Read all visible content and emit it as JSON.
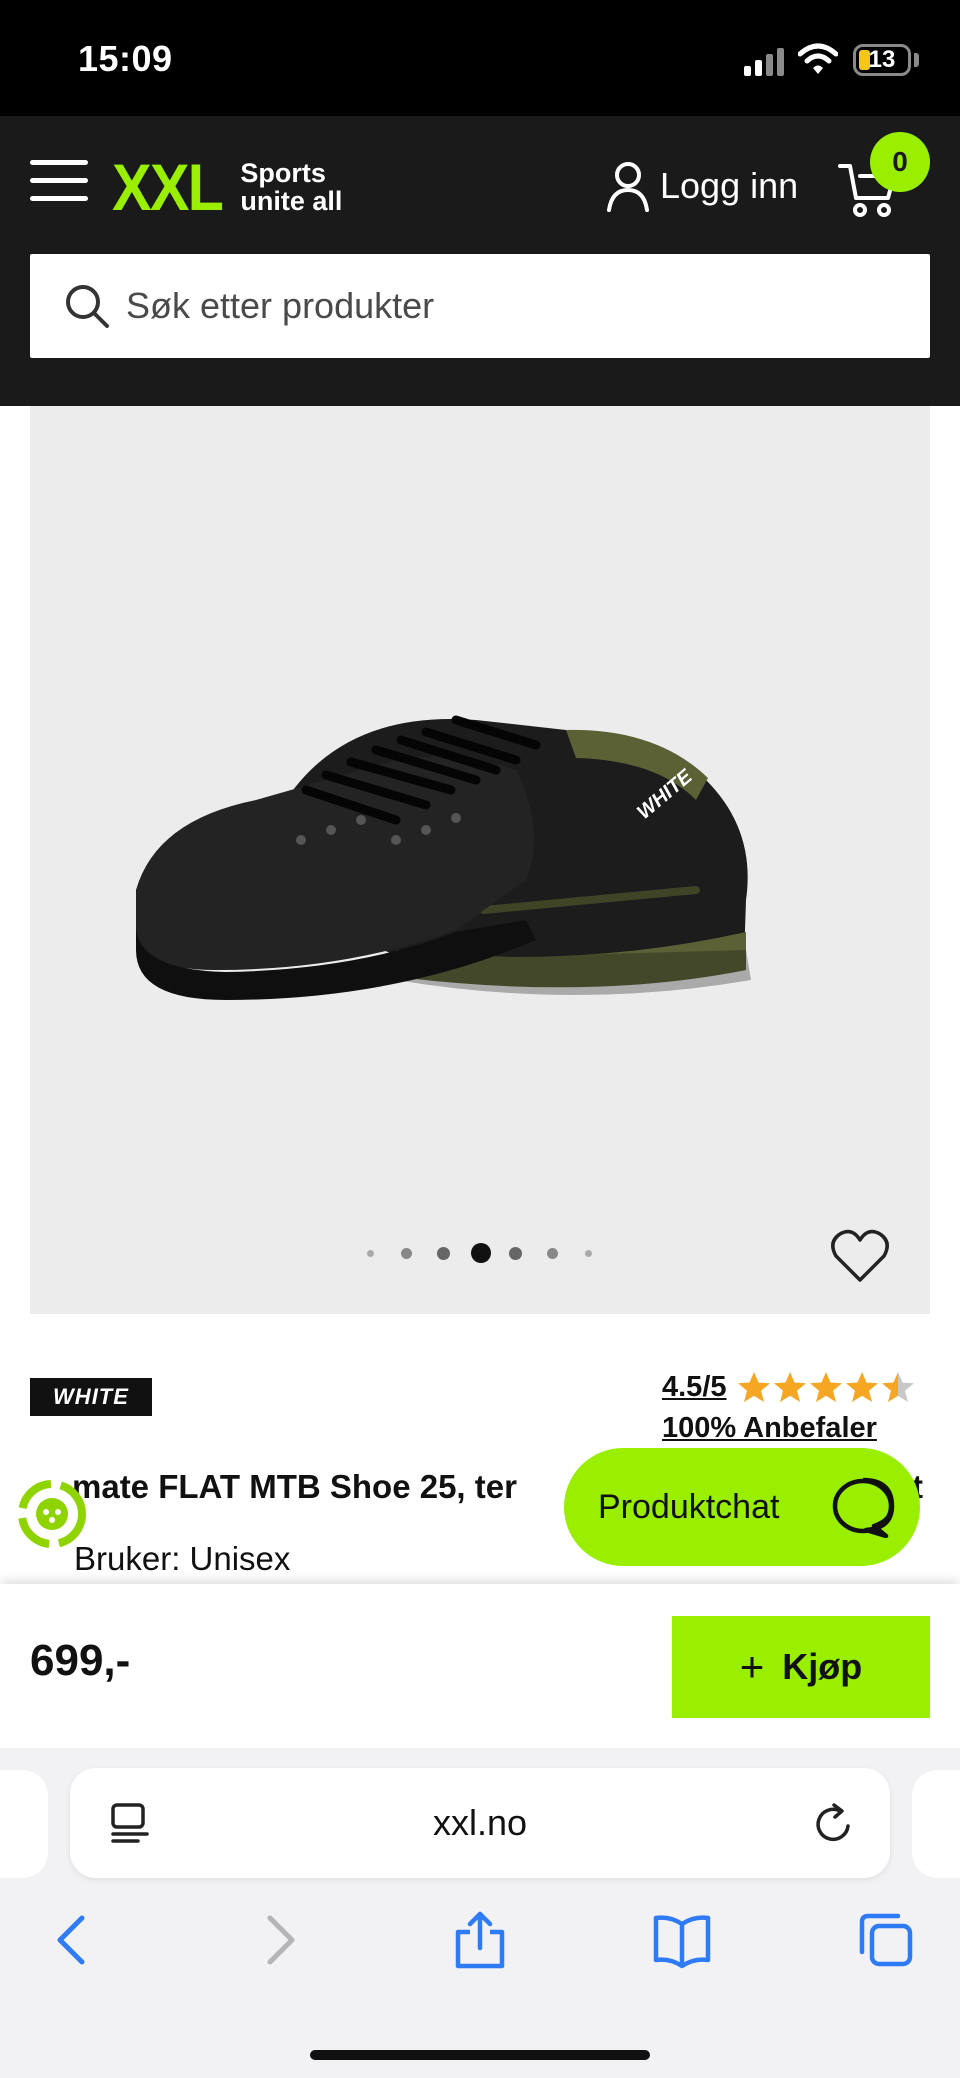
{
  "status_bar": {
    "time": "15:09",
    "battery_level": "13"
  },
  "header": {
    "logo_text": "XXL",
    "logo_tagline_line1": "Sports",
    "logo_tagline_line2": "unite all",
    "login_label": "Logg inn",
    "cart_count": "0",
    "search_placeholder": "Søk etter produkter"
  },
  "gallery": {
    "image_count": 7,
    "active_index": 3
  },
  "product": {
    "brand": "WHITE",
    "rating": "4.5/5",
    "rating_value": 4.5,
    "recommend": "100% Anbefaler",
    "title_visible": "mate FLAT MTB Shoe 25, ter",
    "title_trailing": "t",
    "user": "Bruker: Unisex",
    "price": "699,-",
    "buy_label": "Kjøp"
  },
  "chat": {
    "label": "Produktchat"
  },
  "browser": {
    "url": "xxl.no"
  },
  "colors": {
    "brand_green": "#9aef00",
    "header_bg": "#1a1a1a",
    "star": "#f5a623"
  },
  "icons": [
    "menu-icon",
    "user-icon",
    "cart-icon",
    "search-icon",
    "heart-icon",
    "star-icon",
    "chat-icon",
    "plus-icon",
    "reader-icon",
    "reload-icon",
    "back-icon",
    "forward-icon",
    "share-icon",
    "bookmarks-icon",
    "tabs-icon"
  ]
}
